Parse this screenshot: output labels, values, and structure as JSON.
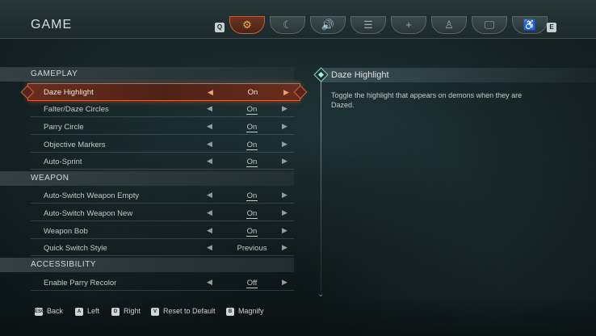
{
  "header": {
    "title": "GAME",
    "prev_key": "Q",
    "next_key": "E",
    "tabs": [
      {
        "icon": "gear-icon",
        "glyph": "⚙"
      },
      {
        "icon": "controller-icon",
        "glyph": "☾"
      },
      {
        "icon": "speaker-icon",
        "glyph": "🔊"
      },
      {
        "icon": "list-icon",
        "glyph": "☰"
      },
      {
        "icon": "crosshair-icon",
        "glyph": "+"
      },
      {
        "icon": "mouse-icon",
        "glyph": "♙"
      },
      {
        "icon": "monitor-icon",
        "glyph": "🖵"
      },
      {
        "icon": "accessibility-icon",
        "glyph": "♿"
      }
    ]
  },
  "sections": {
    "gameplay": "GAMEPLAY",
    "weapon": "WEAPON",
    "accessibility": "ACCESSIBILITY"
  },
  "settings": [
    {
      "label": "Daze Highlight",
      "value": "On"
    },
    {
      "label": "Falter/Daze Circles",
      "value": "On"
    },
    {
      "label": "Parry Circle",
      "value": "On"
    },
    {
      "label": "Objective Markers",
      "value": "On"
    },
    {
      "label": "Auto-Sprint",
      "value": "On"
    },
    {
      "label": "Auto-Switch Weapon Empty",
      "value": "On"
    },
    {
      "label": "Auto-Switch Weapon New",
      "value": "On"
    },
    {
      "label": "Weapon Bob",
      "value": "On"
    },
    {
      "label": "Quick Switch Style",
      "value": "Previous"
    },
    {
      "label": "Enable Parry Recolor",
      "value": "Off"
    }
  ],
  "detail": {
    "title": "Daze Highlight",
    "description": "Toggle the highlight that appears on demons when they are Dazed."
  },
  "footer": {
    "hints": [
      {
        "key": "ESC",
        "label": "Back"
      },
      {
        "key": "A",
        "label": "Left"
      },
      {
        "key": "D",
        "label": "Right"
      },
      {
        "key": "V",
        "label": "Reset to Default"
      },
      {
        "key": "B",
        "label": "Magnify"
      }
    ]
  },
  "colors": {
    "accent": "#d0673e",
    "highlight_fill": "#5a2418",
    "teal": "#86d1c0"
  }
}
